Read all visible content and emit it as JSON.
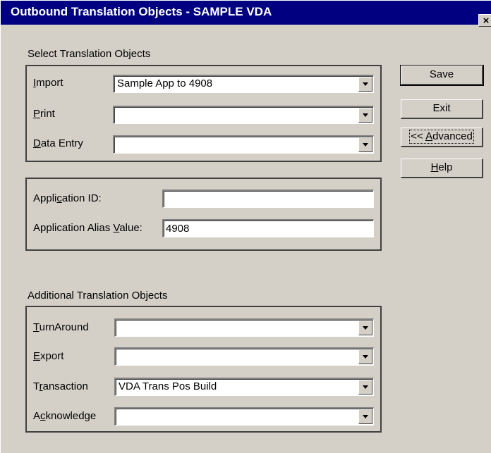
{
  "window": {
    "title": "Outbound Translation Objects - SAMPLE VDA",
    "close_glyph": "×"
  },
  "select_section": {
    "label": "Select Translation Objects",
    "fields": [
      {
        "label_pre": "",
        "label_key": "I",
        "label_post": "mport",
        "value": "Sample App to 4908"
      },
      {
        "label_pre": "",
        "label_key": "P",
        "label_post": "rint",
        "value": ""
      },
      {
        "label_pre": "",
        "label_key": "D",
        "label_post": "ata Entry",
        "value": ""
      }
    ]
  },
  "application_section": {
    "id": {
      "label_pre": "Appli",
      "label_key": "c",
      "label_post": "ation ID:",
      "value": ""
    },
    "alias": {
      "label_pre": "Application Alias ",
      "label_key": "V",
      "label_post": "alue:",
      "value": "4908"
    }
  },
  "additional_section": {
    "label": "Additional Translation Objects",
    "fields": [
      {
        "label_pre": "",
        "label_key": "T",
        "label_post": "urnAround",
        "value": ""
      },
      {
        "label_pre": "",
        "label_key": "E",
        "label_post": "xport",
        "value": ""
      },
      {
        "label_pre": "T",
        "label_key": "r",
        "label_post": "ansaction",
        "value": "VDA Trans Pos Build"
      },
      {
        "label_pre": "A",
        "label_key": "c",
        "label_post": "knowledge",
        "value": ""
      }
    ]
  },
  "buttons": {
    "save": "Save",
    "exit": "Exit",
    "advanced_pre": "<< ",
    "advanced_key": "A",
    "advanced_post": "dvanced",
    "help_pre": "",
    "help_key": "H",
    "help_post": "elp"
  }
}
